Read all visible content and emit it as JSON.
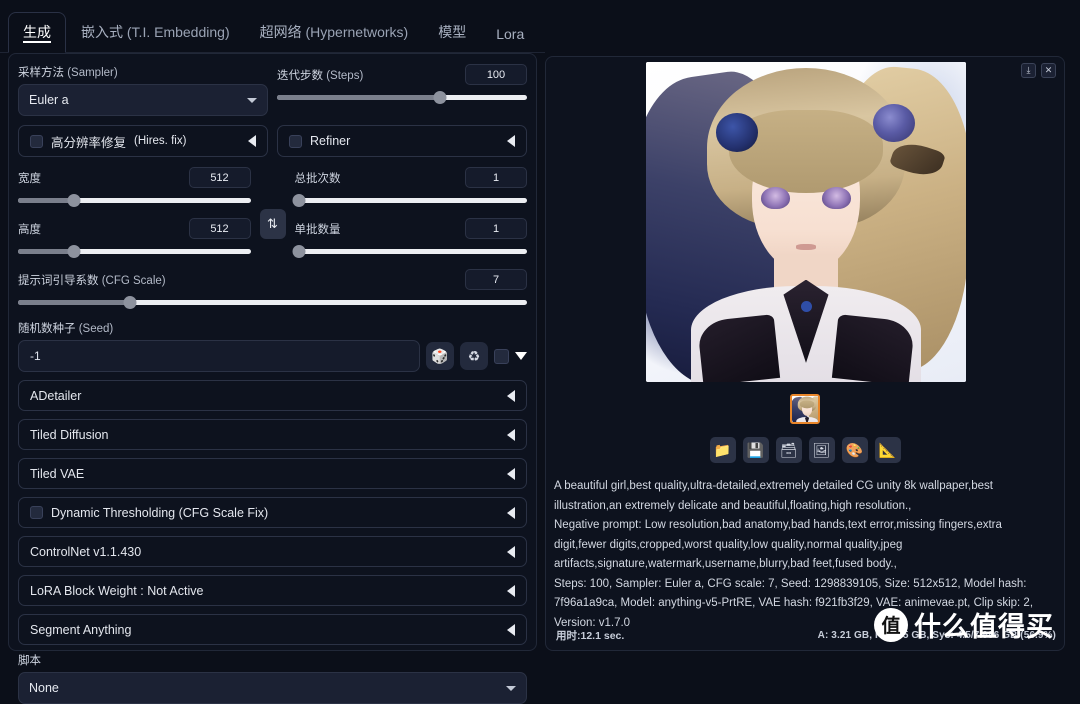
{
  "tabs": [
    {
      "zh": "生成",
      "en": "",
      "active": true
    },
    {
      "zh": "嵌入式",
      "en": "(T.I. Embedding)",
      "active": false
    },
    {
      "zh": "超网络",
      "en": "(Hypernetworks)",
      "active": false
    },
    {
      "zh": "模型",
      "en": "",
      "active": false
    },
    {
      "zh": "Lora",
      "en": "",
      "active": false
    }
  ],
  "sampler": {
    "label_zh": "采样方法",
    "label_en": "(Sampler)",
    "value": "Euler a"
  },
  "steps": {
    "label_zh": "迭代步数",
    "label_en": "(Steps)",
    "value": "100",
    "percent": 65
  },
  "hires": {
    "label_zh": "高分辨率修复",
    "label_en": "(Hires. fix)",
    "checked": false
  },
  "refiner": {
    "label": "Refiner",
    "checked": false
  },
  "width": {
    "label": "宽度",
    "value": "512",
    "percent": 24
  },
  "height": {
    "label": "高度",
    "value": "512",
    "percent": 24
  },
  "batch_count": {
    "label": "总批次数",
    "value": "1",
    "percent": 2
  },
  "batch_size": {
    "label": "单批数量",
    "value": "1",
    "percent": 2
  },
  "swap_icon": "swap-vertical-icon",
  "cfg": {
    "label_zh": "提示词引导系数",
    "label_en": "(CFG Scale)",
    "value": "7",
    "percent": 22
  },
  "seed": {
    "label_zh": "随机数种子",
    "label_en": "(Seed)",
    "value": "-1",
    "dice_icon": "dice-icon",
    "recycle_icon": "recycle-icon",
    "checkbox_checked": false,
    "expand_icon": "triangle-down-icon"
  },
  "accordions": [
    {
      "label": "ADetailer",
      "checkbox": false
    },
    {
      "label": "Tiled Diffusion",
      "checkbox": false
    },
    {
      "label": "Tiled VAE",
      "checkbox": false
    },
    {
      "label": "Dynamic Thresholding (CFG Scale Fix)",
      "checkbox": true
    },
    {
      "label": "ControlNet v1.1.430",
      "checkbox": false
    },
    {
      "label": "LoRA Block Weight : Not Active",
      "checkbox": false
    },
    {
      "label": "Segment Anything",
      "checkbox": false
    }
  ],
  "script": {
    "label": "脚本",
    "value": "None"
  },
  "preview": {
    "download_icon": "download-icon",
    "close_icon": "close-icon",
    "thumbnail_name": "gallery-thumbnail"
  },
  "toolbar_icons": [
    {
      "name": "folder-icon",
      "glyph": "📁"
    },
    {
      "name": "save-icon",
      "glyph": "💾"
    },
    {
      "name": "zip-icon",
      "glyph": "🗃"
    },
    {
      "name": "send-to-img2img-icon",
      "glyph": "🖼"
    },
    {
      "name": "palette-icon",
      "glyph": "🎨"
    },
    {
      "name": "ruler-icon",
      "glyph": "📐"
    }
  ],
  "generation_info": {
    "prompt": "A beautiful girl,best quality,ultra-detailed,extremely detailed CG unity 8k wallpaper,best illustration,an extremely delicate and beautiful,floating,high resolution.,",
    "negative": "Negative prompt: Low resolution,bad anatomy,bad hands,text error,missing fingers,extra digit,fewer digits,cropped,worst quality,low quality,normal quality,jpeg artifacts,signature,watermark,username,blurry,bad feet,fused body.,",
    "params": "Steps: 100, Sampler: Euler a, CFG scale: 7, Seed: 1298839105, Size: 512x512, Model hash: 7f96a1a9ca, Model: anything-v5-PrtRE, VAE hash: f921fb3f29, VAE: animevae.pt, Clip skip: 2, Version: v1.7.0"
  },
  "status": {
    "time": "用时:12.1 sec.",
    "memory": "A: 3.21 GB, R: 3.85 GB, Sys: 4.5/7.996 GB (56.9%)"
  },
  "watermark": {
    "logo_char": "值",
    "text": "什么值得买"
  },
  "colors": {
    "accent_orange": "#e8862b",
    "panel_bg": "#0d121e",
    "page_bg": "#0b0f19",
    "border": "#2b3245"
  }
}
